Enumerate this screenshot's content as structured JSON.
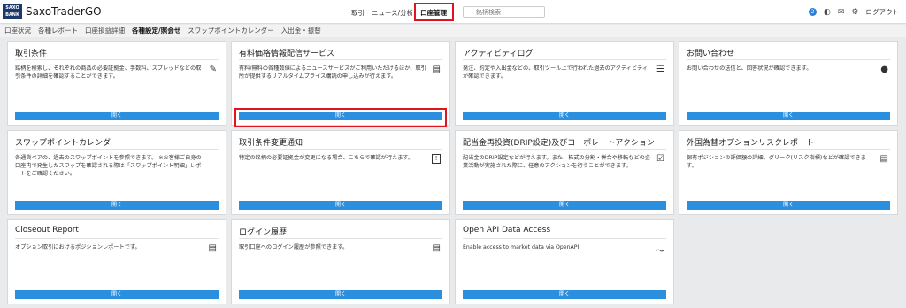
{
  "app": {
    "logo_line1": "SAXO",
    "logo_line2": "BANK",
    "brand": "SaxoTraderGO"
  },
  "nav": {
    "items": [
      "取引",
      "ニュース/分析",
      "口座管理"
    ],
    "search_placeholder": "銘柄検索"
  },
  "header_right": {
    "badge_count": "2",
    "logout": "ログアウト"
  },
  "subnav": {
    "items": [
      "口座状況",
      "各種レポート",
      "口座損益詳細",
      "各種設定/照会せ",
      "スワップポイントカレンダー",
      "入出金・振替"
    ]
  },
  "cards": [
    {
      "title": "取引条件",
      "desc": "銘柄を検索し、それぞれの商品の必要証拠金、手数料、スプレッドなどの取引条件の詳細を確認することができます。",
      "icon": "✎",
      "button": "開く"
    },
    {
      "title": "有料価格情報配信サービス",
      "desc": "有料/無料の各種数値によるニュースサービスがご利用いただけるほか、取引所が提供するリアルタイムプライス購読の申し込みが行えます。",
      "icon": "▤",
      "button": "開く"
    },
    {
      "title": "アクティビティログ",
      "desc": "発注、約定や入出金などの、取引ツール上で行われた過去のアクティビティが確認できます。",
      "icon": "☰",
      "button": "開く"
    },
    {
      "title": "お問い合わせ",
      "desc": "お問い合わせの送信と、回答状況が確認できます。",
      "icon": "●",
      "button": "開く"
    },
    {
      "title": "スワップポイントカレンダー",
      "desc": "各通貨ペアの、過去のスワップポイントを参照できます。 ※お客様ご自身の口座内で発生したスワップを確認される際は「スワップポイント明細」レポートをご確認ください。",
      "icon": "",
      "button": "開く"
    },
    {
      "title": "取引条件変更通知",
      "desc": "特定の銘柄の必要証拠金が変更になる場合、こちらで確認が行えます。",
      "icon": "!",
      "button": "開く"
    },
    {
      "title": "配当金再投資(DRIP設定)及びコーポレートアクション",
      "desc": "配当金のDRIP設定などが行えます。また、株式の分割・併合や移転などの企業活動が実施された際に、任意のアクションを行うことができます。",
      "icon": "☑",
      "button": "開く"
    },
    {
      "title": "外国為替オプションリスクレポート",
      "desc": "保有ポジションの評価額の詳細、グリーク(リスク指標)などが確認できます。",
      "icon": "▤",
      "button": "開く"
    },
    {
      "title": "Closeout Report",
      "desc": "オプション取引におけるポジションレポートです。",
      "icon": "▤",
      "button": "開く"
    },
    {
      "title": "ログイン履歴",
      "desc": "取引口座へのログイン履歴が参照できます。",
      "icon": "▤",
      "button": "開く"
    },
    {
      "title": "Open API Data Access",
      "desc": "Enable access to market data via OpenAPI",
      "icon": "〜",
      "button": "開く"
    }
  ],
  "colors": {
    "button": "#2b8fe0",
    "highlight": "#e0141e",
    "logo": "#1b3a6b"
  }
}
